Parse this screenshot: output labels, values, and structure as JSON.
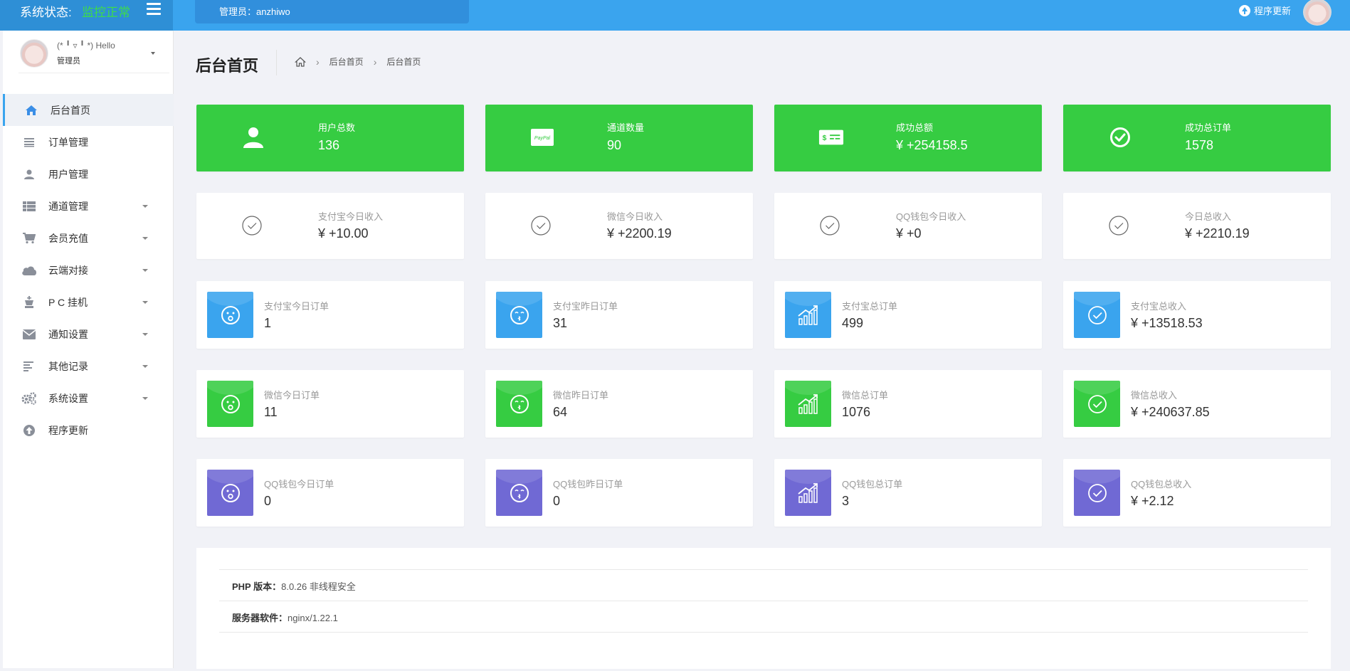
{
  "header": {
    "status_label": "系统状态:",
    "status_value": "监控正常",
    "admin_text": "管理员：anzhiwo",
    "update_label": "程序更新"
  },
  "sidebar": {
    "user_greeting": "(* ╹ ▿ ╹ *) Hello",
    "user_role": "管理员",
    "items": [
      {
        "label": "后台首页",
        "icon": "home-icon",
        "active": true
      },
      {
        "label": "订单管理",
        "icon": "list-icon"
      },
      {
        "label": "用户管理",
        "icon": "user-icon"
      },
      {
        "label": "通道管理",
        "icon": "grid-icon",
        "has_submenu": true
      },
      {
        "label": "会员充值",
        "icon": "cart-icon",
        "has_submenu": true
      },
      {
        "label": "云端对接",
        "icon": "cloud-icon",
        "has_submenu": true
      },
      {
        "label": "P C 挂机",
        "icon": "chess-king-icon",
        "has_submenu": true
      },
      {
        "label": "通知设置",
        "icon": "envelope-icon",
        "has_submenu": true
      },
      {
        "label": "其他记录",
        "icon": "align-left-icon",
        "has_submenu": true
      },
      {
        "label": "系统设置",
        "icon": "gears-icon",
        "has_submenu": true
      },
      {
        "label": "程序更新",
        "icon": "arrow-circle-up-icon"
      }
    ]
  },
  "page": {
    "title": "后台首页",
    "breadcrumb": [
      "后台首页",
      "后台首页"
    ]
  },
  "summary": [
    {
      "label": "用户总数",
      "value": "136",
      "icon": "user-icon"
    },
    {
      "label": "通道数量",
      "value": "90",
      "icon": "paypal-icon"
    },
    {
      "label": "成功总额",
      "value": "¥ +254158.5",
      "icon": "money-card-icon"
    },
    {
      "label": "成功总订单",
      "value": "1578",
      "icon": "check-circle-icon"
    }
  ],
  "today_income": [
    {
      "label": "支付宝今日收入",
      "value": "¥ +10.00"
    },
    {
      "label": "微信今日收入",
      "value": "¥ +2200.19"
    },
    {
      "label": "QQ钱包今日收入",
      "value": "¥ +0"
    },
    {
      "label": "今日总收入",
      "value": "¥ +2210.19"
    }
  ],
  "alipay_stats": [
    {
      "label": "支付宝今日订单",
      "value": "1"
    },
    {
      "label": "支付宝昨日订单",
      "value": "31"
    },
    {
      "label": "支付宝总订单",
      "value": "499"
    },
    {
      "label": "支付宝总收入",
      "value": "¥ +13518.53"
    }
  ],
  "wechat_stats": [
    {
      "label": "微信今日订单",
      "value": "11"
    },
    {
      "label": "微信昨日订单",
      "value": "64"
    },
    {
      "label": "微信总订单",
      "value": "1076"
    },
    {
      "label": "微信总收入",
      "value": "¥ +240637.85"
    }
  ],
  "qq_stats": [
    {
      "label": "QQ钱包今日订单",
      "value": "0"
    },
    {
      "label": "QQ钱包昨日订单",
      "value": "0"
    },
    {
      "label": "QQ钱包总订单",
      "value": "3"
    },
    {
      "label": "QQ钱包总收入",
      "value": "¥ +2.12"
    }
  ],
  "server_info": {
    "php_label": "PHP 版本：",
    "php_value": "8.0.26 非线程安全",
    "server_label": "服务器软件：",
    "server_value": "nginx/1.22.1"
  },
  "colors": {
    "topbar": "#3aa4ee",
    "green": "#36cc42",
    "blue": "#3aa4ee",
    "purple": "#7069d4",
    "status_ok": "#3ddc4a"
  }
}
